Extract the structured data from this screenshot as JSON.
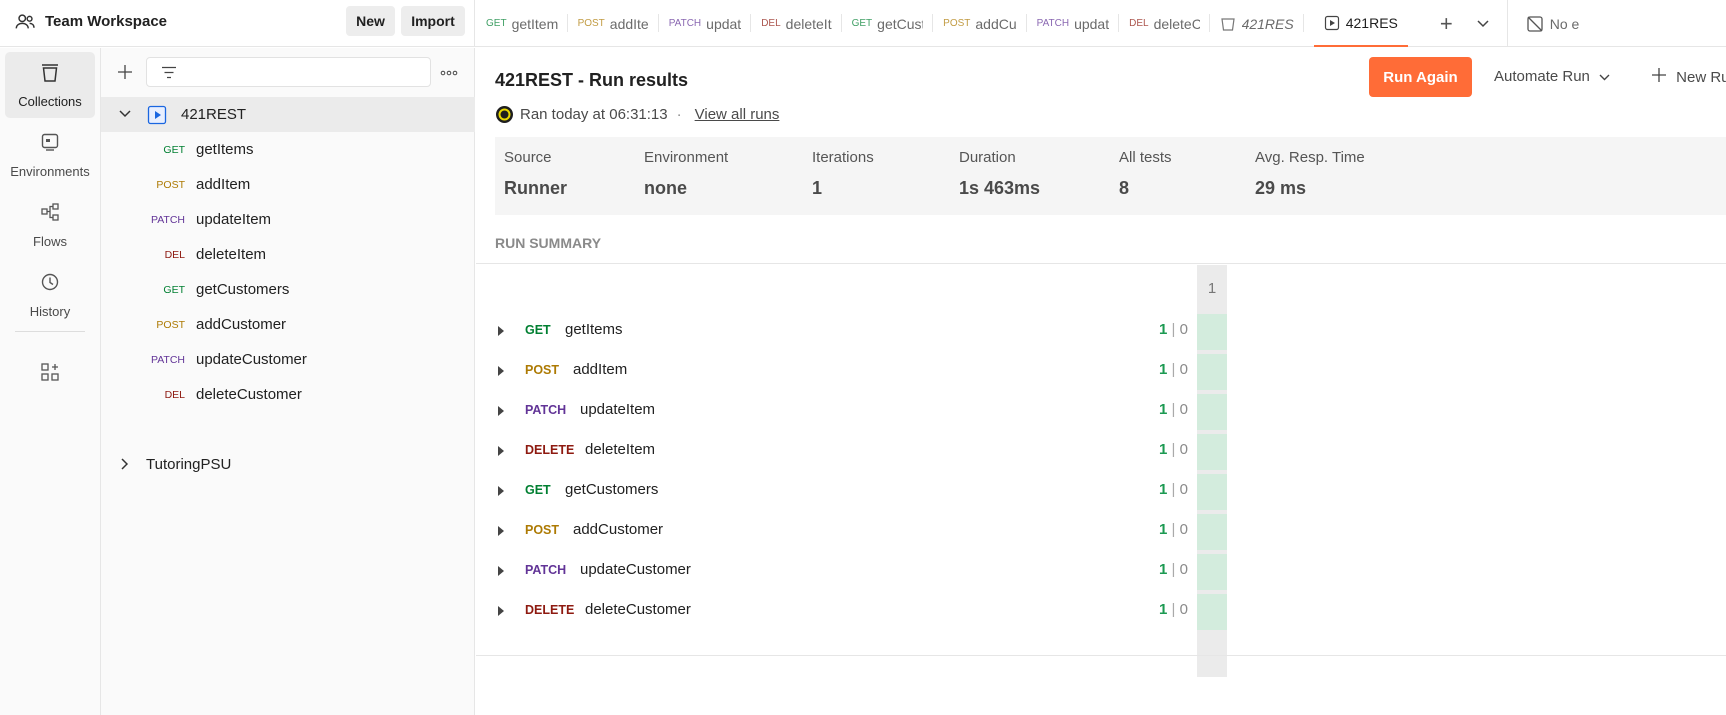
{
  "workspace": {
    "title": "Team Workspace",
    "new_label": "New",
    "import_label": "Import"
  },
  "tabs": [
    {
      "method": "GET",
      "name": "getItems",
      "cls": "c-get"
    },
    {
      "method": "POST",
      "name": "addIte",
      "cls": "c-post"
    },
    {
      "method": "PATCH",
      "name": "updat",
      "cls": "c-patch"
    },
    {
      "method": "DEL",
      "name": "deleteIt",
      "cls": "c-del"
    },
    {
      "method": "GET",
      "name": "getCust",
      "cls": "c-get"
    },
    {
      "method": "POST",
      "name": "addCu",
      "cls": "c-post"
    },
    {
      "method": "PATCH",
      "name": "updat",
      "cls": "c-patch"
    },
    {
      "method": "DEL",
      "name": "deleteC",
      "cls": "c-del"
    }
  ],
  "runner_tabs": [
    {
      "name": "421RES"
    },
    {
      "name": "421RES"
    }
  ],
  "env_label": "No e",
  "rail": [
    {
      "label": "Collections",
      "icon": "collections-icon"
    },
    {
      "label": "Environments",
      "icon": "environments-icon"
    },
    {
      "label": "Flows",
      "icon": "flows-icon"
    },
    {
      "label": "History",
      "icon": "history-icon"
    }
  ],
  "sidebar": {
    "filter_placeholder": "",
    "collection": "421REST",
    "requests": [
      {
        "method": "GET",
        "name": "getItems",
        "cls": "c-get"
      },
      {
        "method": "POST",
        "name": "addItem",
        "cls": "c-post"
      },
      {
        "method": "PATCH",
        "name": "updateItem",
        "cls": "c-patch"
      },
      {
        "method": "DEL",
        "name": "deleteItem",
        "cls": "c-del"
      },
      {
        "method": "GET",
        "name": "getCustomers",
        "cls": "c-get"
      },
      {
        "method": "POST",
        "name": "addCustomer",
        "cls": "c-post"
      },
      {
        "method": "PATCH",
        "name": "updateCustomer",
        "cls": "c-patch"
      },
      {
        "method": "DEL",
        "name": "deleteCustomer",
        "cls": "c-del"
      }
    ],
    "other_collection": "TutoringPSU"
  },
  "main": {
    "title": "421REST - Run results",
    "ran_text": "Ran today at 06:31:13",
    "dot": "·",
    "view_all": "View all runs",
    "run_again": "Run Again",
    "automate": "Automate Run",
    "new_run": "New Ru",
    "stats": [
      {
        "label": "Source",
        "value": "Runner"
      },
      {
        "label": "Environment",
        "value": "none"
      },
      {
        "label": "Iterations",
        "value": "1"
      },
      {
        "label": "Duration",
        "value": "1s 463ms"
      },
      {
        "label": "All tests",
        "value": "8"
      },
      {
        "label": "Avg. Resp. Time",
        "value": "29 ms"
      }
    ],
    "summary_label": "RUN SUMMARY",
    "iteration_header": "1",
    "summary": [
      {
        "method": "GET",
        "name": "getItems",
        "cls": "c-get",
        "pass": "1",
        "sep": "|",
        "fail": "0"
      },
      {
        "method": "POST",
        "name": "addItem",
        "cls": "c-post",
        "pass": "1",
        "sep": "|",
        "fail": "0"
      },
      {
        "method": "PATCH",
        "name": "updateItem",
        "cls": "c-patch",
        "pass": "1",
        "sep": "|",
        "fail": "0"
      },
      {
        "method": "DELETE",
        "name": "deleteItem",
        "cls": "c-del",
        "pass": "1",
        "sep": "|",
        "fail": "0"
      },
      {
        "method": "GET",
        "name": "getCustomers",
        "cls": "c-get",
        "pass": "1",
        "sep": "|",
        "fail": "0"
      },
      {
        "method": "POST",
        "name": "addCustomer",
        "cls": "c-post",
        "pass": "1",
        "sep": "|",
        "fail": "0"
      },
      {
        "method": "PATCH",
        "name": "updateCustomer",
        "cls": "c-patch",
        "pass": "1",
        "sep": "|",
        "fail": "0"
      },
      {
        "method": "DELETE",
        "name": "deleteCustomer",
        "cls": "c-del",
        "pass": "1",
        "sep": "|",
        "fail": "0"
      }
    ]
  },
  "colors": {
    "accent": "#ff6c37",
    "get": "#007f31",
    "post": "#ad7a03",
    "patch": "#623497",
    "delete": "#8e1a10",
    "pass_cell": "#d3ecdd"
  }
}
